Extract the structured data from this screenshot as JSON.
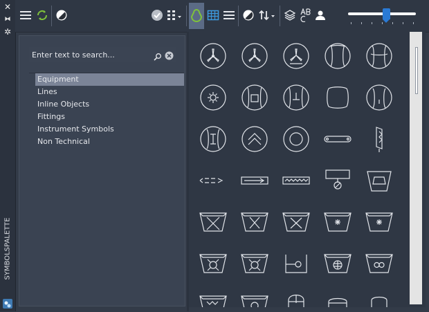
{
  "palette": {
    "vertical_title": "SYMBOLSPALETTE"
  },
  "search": {
    "placeholder": "Enter text to search..."
  },
  "categories": [
    {
      "label": "Equipment",
      "selected": true
    },
    {
      "label": "Lines",
      "selected": false
    },
    {
      "label": "Inline Objects",
      "selected": false
    },
    {
      "label": "Fittings",
      "selected": false
    },
    {
      "label": "Instrument Symbols",
      "selected": false
    },
    {
      "label": "Non Technical",
      "selected": false
    }
  ],
  "slider": {
    "value": 0.58
  },
  "toolbar": {
    "icons": [
      "menu-icon",
      "sync-icon",
      "contrast-icon",
      "check-icon",
      "view-options-icon",
      "filter-icon",
      "table-icon",
      "list-icon",
      "contrast-icon",
      "sort-icon",
      "layers-icon",
      "spellcheck-icon",
      "user-icon"
    ]
  },
  "symbols": [
    "fan-1",
    "fan-2",
    "fan-3",
    "vessel-1",
    "vessel-2",
    "sun-vessel",
    "square-vessel",
    "t-vessel",
    "vessel-3",
    "vessel-4",
    "i-vessel",
    "chevron-vessel",
    "ring-vessel",
    "conveyor",
    "screw",
    "arrow-line",
    "box-arrow",
    "zigzag-box",
    "box-circle",
    "trapezoid-box",
    "x-hopper-1",
    "x-hopper-2",
    "x-hopper-3",
    "sparkle-hopper-1",
    "sparkle-hopper-2",
    "circle-hopper-1",
    "circle-hopper-2",
    "lollipop-hopper",
    "globe-hopper",
    "infinity-hopper",
    "partial-1",
    "partial-2",
    "partial-3",
    "partial-4",
    "partial-5"
  ],
  "colors": {
    "accent": "#2a7ad5",
    "selected_item": "#7b8497",
    "active_tool": "#5b6b86"
  }
}
